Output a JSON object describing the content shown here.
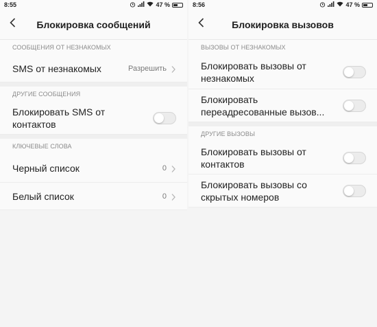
{
  "left": {
    "status": {
      "time": "8:55",
      "battery": "47 %"
    },
    "title": "Блокировка сообщений",
    "sections": {
      "unknown": "СООБЩЕНИЯ ОТ НЕЗНАКОМЫХ",
      "other": "ДРУГИЕ СООБЩЕНИЯ",
      "keywords": "КЛЮЧЕВЫЕ СЛОВА"
    },
    "rows": {
      "sms_unknown": {
        "label": "SMS от незнакомых",
        "value": "Разрешить"
      },
      "block_contacts": {
        "label": "Блокировать SMS от контактов",
        "checked": false
      },
      "blacklist": {
        "label": "Черный список",
        "value": "0"
      },
      "whitelist": {
        "label": "Белый список",
        "value": "0"
      }
    }
  },
  "right": {
    "status": {
      "time": "8:56",
      "battery": "47 %"
    },
    "title": "Блокировка вызовов",
    "sections": {
      "unknown": "ВЫЗОВЫ ОТ НЕЗНАКОМЫХ",
      "other": "ДРУГИЕ ВЫЗОВЫ"
    },
    "rows": {
      "block_unknown": {
        "label": "Блокировать вызовы от незнакомых",
        "checked": false
      },
      "block_forwarded": {
        "label": "Блокировать переадресованные вызов...",
        "checked": false
      },
      "block_contacts": {
        "label": "Блокировать вызовы от контактов",
        "checked": false
      },
      "block_hidden": {
        "label": "Блокировать вызовы со скрытых номеров",
        "checked": false
      }
    }
  },
  "colors": {
    "background": "#f4f4f4",
    "surface": "#fafafa",
    "toggle_off": "#ececec"
  }
}
